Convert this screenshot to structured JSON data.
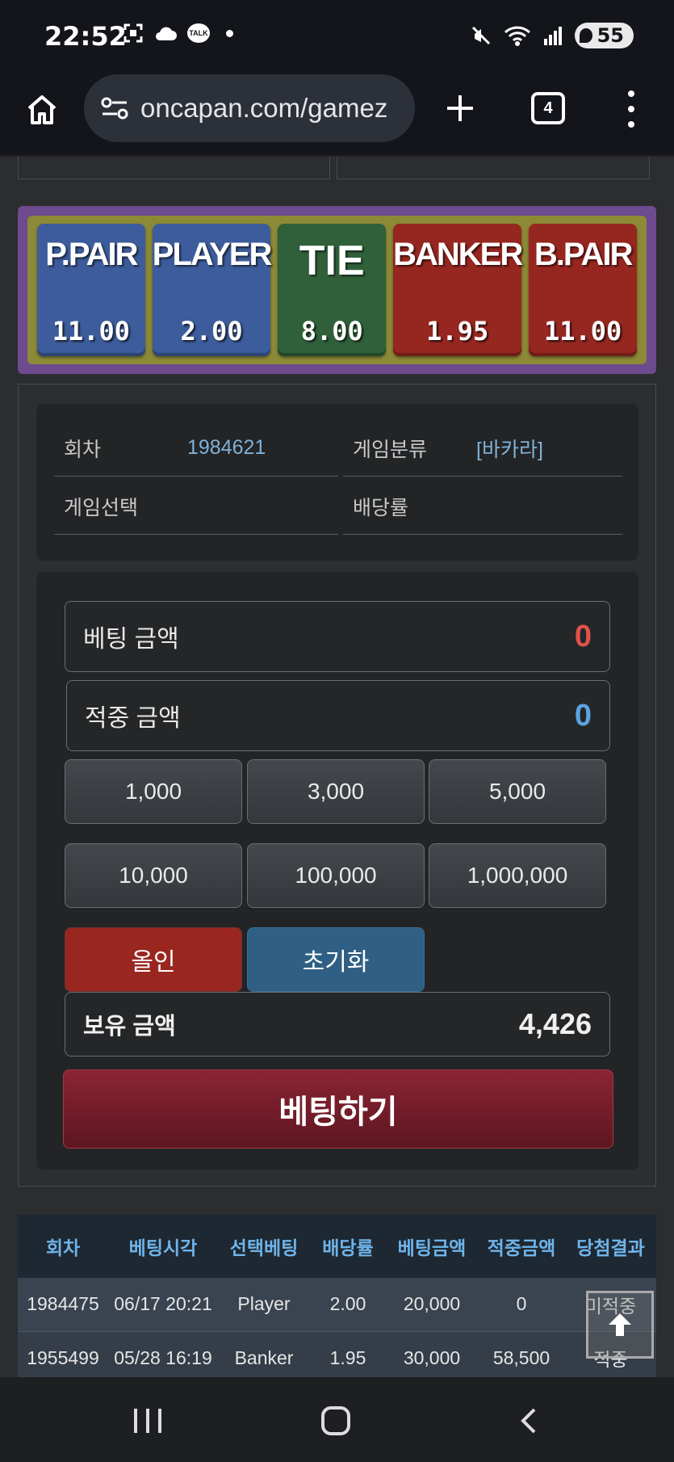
{
  "status_bar": {
    "time": "22:52",
    "talk_badge": "TALK",
    "battery": "55",
    "icons": [
      "screenshot-icon",
      "cloud-icon",
      "talk-icon",
      "mute-icon",
      "wifi-icon",
      "signal-icon"
    ]
  },
  "browser": {
    "url": "oncapan.com/gamez",
    "tab_count": "4"
  },
  "bet_options": [
    {
      "label": "P.PAIR",
      "odds": "11.00",
      "color": "#3d5c9b"
    },
    {
      "label": "PLAYER",
      "odds": "2.00",
      "color": "#3d5c9b"
    },
    {
      "label": "TIE",
      "odds": "8.00",
      "color": "#2f603a"
    },
    {
      "label": "BANKER",
      "odds": "1.95",
      "color": "#962620"
    },
    {
      "label": "B.PAIR",
      "odds": "11.00",
      "color": "#962620"
    }
  ],
  "info": {
    "round_label": "회차",
    "round_value": "1984621",
    "category_label": "게임분류",
    "category_value": "[바카라]",
    "selection_label": "게임선택",
    "selection_value": "",
    "odds_label": "배당률",
    "odds_value": ""
  },
  "bet": {
    "bet_amount_label": "베팅 금액",
    "bet_amount_value": "0",
    "win_amount_label": "적중 금액",
    "win_amount_value": "0",
    "chips": [
      "1,000",
      "3,000",
      "5,000",
      "10,000",
      "100,000",
      "1,000,000"
    ],
    "allin_label": "올인",
    "reset_label": "초기화",
    "balance_label": "보유 금액",
    "balance_value": "4,426",
    "submit_label": "베팅하기"
  },
  "history": {
    "headers": [
      "회차",
      "베팅시각",
      "선택베팅",
      "배당률",
      "베팅금액",
      "적중금액",
      "당첨결과"
    ],
    "rows": [
      [
        "1984475",
        "06/17 20:21",
        "Player",
        "2.00",
        "20,000",
        "0",
        "미적중"
      ],
      [
        "1955499",
        "05/28 16:19",
        "Banker",
        "1.95",
        "30,000",
        "58,500",
        "적중"
      ]
    ]
  },
  "colors": {
    "accent_red": "#e0524a",
    "accent_blue": "#5aa3e3",
    "header_blue": "#6fb4ea"
  }
}
